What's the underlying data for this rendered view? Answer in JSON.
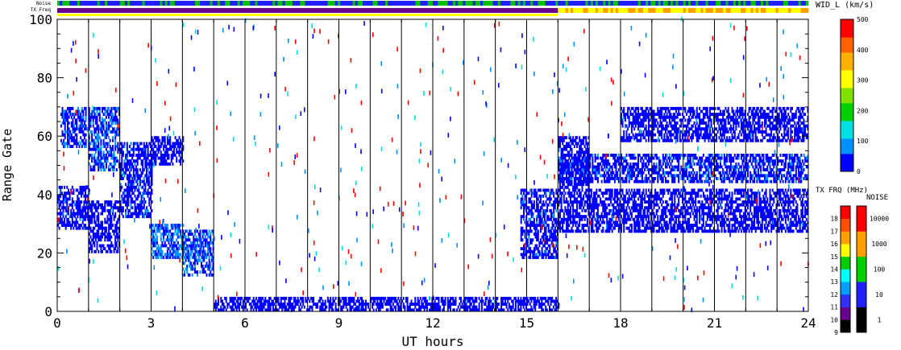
{
  "strip_labels": {
    "noise": "Noise",
    "txfreq": "TX Freq"
  },
  "colorbars": {
    "width": {
      "title": "WID_L (km/s)",
      "ticks": [
        "0",
        "100",
        "200",
        "300",
        "400",
        "500"
      ],
      "colors": [
        "#0000ff",
        "#0090ff",
        "#00e0e0",
        "#00d000",
        "#80e000",
        "#ffff00",
        "#ffb000",
        "#ff6000",
        "#ff0000"
      ]
    },
    "txfreq": {
      "title": "TX FRQ (MHz)",
      "ticks": [
        "9",
        "10",
        "11",
        "12",
        "13",
        "14",
        "15",
        "16",
        "17",
        "18"
      ],
      "colors": [
        "#000000",
        "#6a0090",
        "#3030ff",
        "#00a0ff",
        "#00ffff",
        "#00cc00",
        "#ffff00",
        "#ffa000",
        "#ff5000",
        "#ff0000"
      ]
    },
    "noise": {
      "title": "NOISE",
      "ticks": [
        "1",
        "10",
        "100",
        "1000",
        "10000"
      ],
      "colors": [
        "#000000",
        "#2020ff",
        "#00d000",
        "#ffa000",
        "#ff0000"
      ]
    }
  },
  "chart_data": {
    "type": "heatmap",
    "xlabel": "UT hours",
    "ylabel": "Range Gate",
    "xlim": [
      0,
      24
    ],
    "ylim": [
      0,
      100
    ],
    "xticks": [
      0,
      3,
      6,
      9,
      12,
      15,
      18,
      21,
      24
    ],
    "yticks": [
      0,
      20,
      40,
      60,
      80,
      100
    ],
    "scan_boundaries": [
      1,
      2,
      3,
      4,
      5,
      6,
      7,
      8,
      9,
      10,
      11,
      12,
      13,
      14,
      15,
      16,
      17,
      18,
      19,
      20,
      21,
      22,
      23
    ],
    "echo_regions": [
      {
        "x": [
          0.0,
          1.0
        ],
        "y": [
          28,
          43
        ],
        "value": 30
      },
      {
        "x": [
          0.1,
          0.9
        ],
        "y": [
          56,
          70
        ],
        "value": 40
      },
      {
        "x": [
          1.0,
          2.0
        ],
        "y": [
          20,
          38
        ],
        "value": 20
      },
      {
        "x": [
          1.0,
          2.0
        ],
        "y": [
          48,
          70
        ],
        "value": 45
      },
      {
        "x": [
          2.0,
          3.0
        ],
        "y": [
          32,
          58
        ],
        "value": 30
      },
      {
        "x": [
          3.0,
          4.0
        ],
        "y": [
          50,
          60
        ],
        "value": 25
      },
      {
        "x": [
          3.0,
          4.0
        ],
        "y": [
          18,
          30
        ],
        "value": 60
      },
      {
        "x": [
          4.0,
          5.0
        ],
        "y": [
          12,
          28
        ],
        "value": 50
      },
      {
        "x": [
          5.0,
          16.0
        ],
        "y": [
          0,
          5
        ],
        "value": 15
      },
      {
        "x": [
          14.8,
          16.0
        ],
        "y": [
          18,
          42
        ],
        "value": 30
      },
      {
        "x": [
          16.0,
          24.0
        ],
        "y": [
          27,
          42
        ],
        "value": 20
      },
      {
        "x": [
          16.0,
          17.0
        ],
        "y": [
          42,
          60
        ],
        "value": 25
      },
      {
        "x": [
          18.0,
          24.0
        ],
        "y": [
          58,
          70
        ],
        "value": 25
      },
      {
        "x": [
          16.0,
          24.0
        ],
        "y": [
          44,
          54
        ],
        "value": 35
      }
    ]
  }
}
